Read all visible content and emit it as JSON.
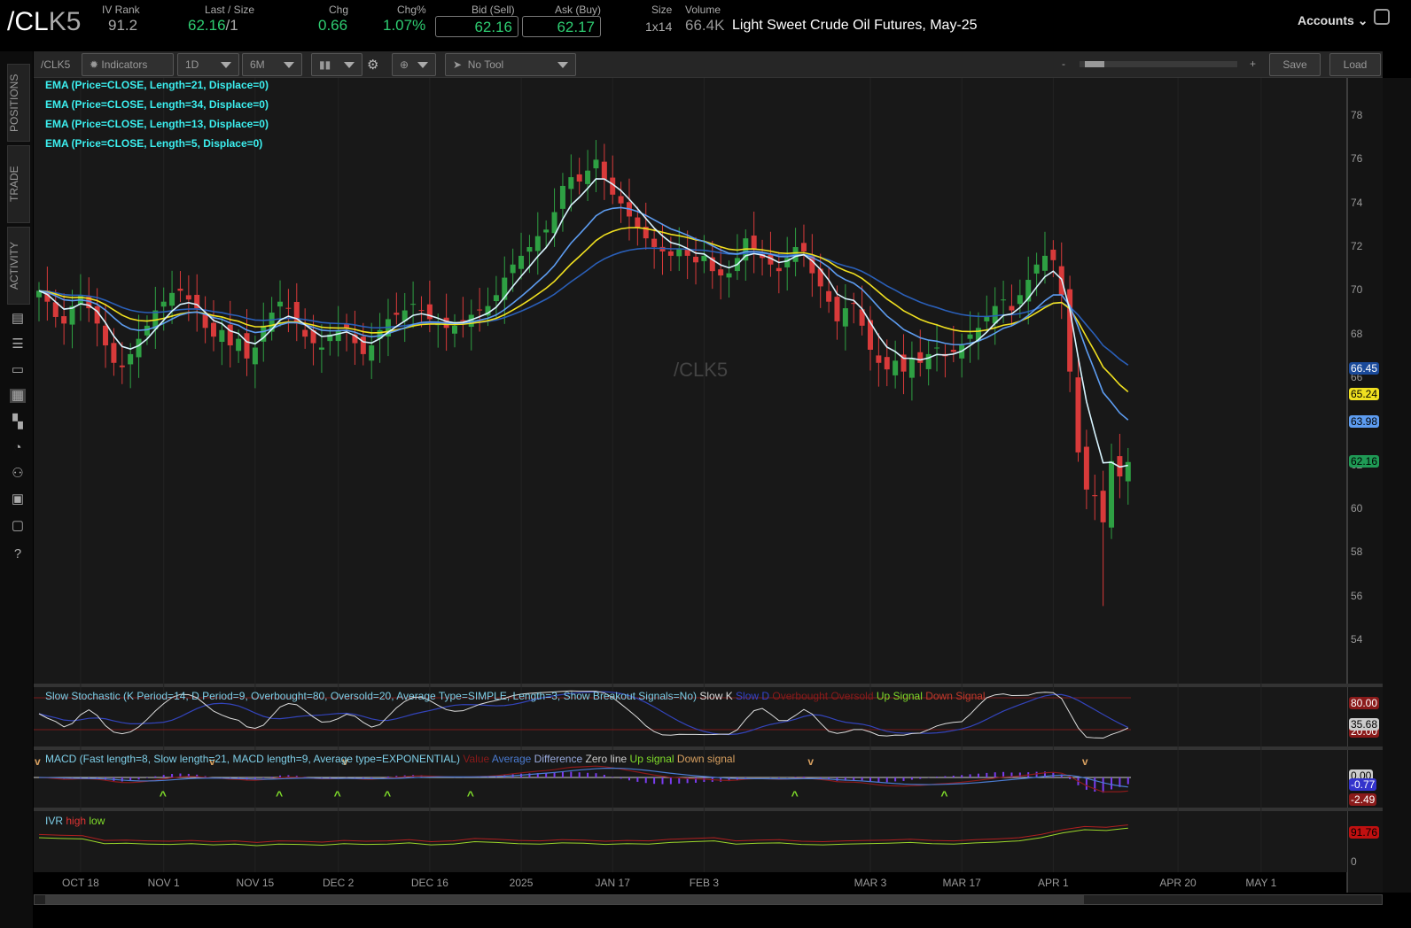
{
  "header": {
    "symbol_a": "/CL",
    "symbol_b": "K5",
    "iv_rank_label": "IV Rank",
    "iv_rank": "91.2",
    "last_label": "Last / Size",
    "last": "62.16",
    "size": "/1",
    "chg_label": "Chg",
    "chg": "0.66",
    "chgp_label": "Chg%",
    "chgp": "1.07%",
    "bid_label": "Bid (Sell)",
    "bid": "62.16",
    "ask_label": "Ask (Buy)",
    "ask": "62.17",
    "size_label": "Size",
    "size_val": "1x14",
    "volume_label": "Volume",
    "volume": "66.4K",
    "description": "Light Sweet Crude Oil Futures, May-25",
    "accounts": "Accounts"
  },
  "toolbar": {
    "symbol": "/CLK5",
    "indicators": "Indicators",
    "interval": "1D",
    "range": "6M",
    "tool": "No Tool",
    "zoom_minus": "-",
    "zoom_plus": "+",
    "save": "Save",
    "load": "Load"
  },
  "sidebar": {
    "tabs": [
      "POSITIONS",
      "TRADE",
      "ACTIVITY"
    ]
  },
  "studies": [
    "EMA (Price=CLOSE, Length=21, Displace=0)",
    "EMA (Price=CLOSE, Length=34, Displace=0)",
    "EMA (Price=CLOSE, Length=13, Displace=0)",
    "EMA (Price=CLOSE, Length=5, Displace=0)"
  ],
  "watermark": "/CLK5",
  "stoch": {
    "title": "Slow Stochastic (K Period=14, D Period=9, Overbought=80, Oversold=20, Average Type=SIMPLE, Length=3, Show Breakout Signals=No)",
    "legend": [
      "Slow K",
      "Slow D",
      "Overbought",
      "Oversold",
      "Up Signal",
      "Down Signal"
    ],
    "tags": [
      "80.00",
      "35.68",
      "20.00"
    ]
  },
  "macd": {
    "title": "MACD (Fast length=8, Slow length=21, MACD length=9, Average type=EXPONENTIAL)",
    "legend": [
      "Value",
      "Average",
      "Difference",
      "Zero line",
      "Up signal",
      "Down signal"
    ],
    "tags": [
      "0.00",
      "-0.77",
      "-2.49"
    ]
  },
  "ivr": {
    "title": "IVR",
    "legend": [
      "high",
      "low"
    ],
    "tags": [
      "91.76",
      "0"
    ],
    "series": [
      60,
      58,
      57,
      45,
      46,
      44,
      43,
      45,
      42,
      44,
      40,
      44,
      43,
      41,
      45,
      43,
      44,
      47,
      42,
      44,
      50,
      48,
      45,
      44,
      47,
      46,
      43,
      45,
      44,
      48,
      50,
      52,
      44,
      46,
      47,
      43,
      42,
      44,
      45,
      46,
      48,
      45,
      44,
      47,
      49,
      52,
      60,
      72,
      80,
      78,
      84
    ]
  },
  "price_tags": {
    "ema34": "66.45",
    "ema21": "65.24",
    "ema13": "63.98",
    "last": "62.16"
  },
  "colors": {
    "up": "#2ea043",
    "down": "#d83a3a",
    "ema21": "#f0e020",
    "ema34": "#2a5fb8",
    "ema13": "#5d9cf0",
    "ema5": "#d8f4ff"
  },
  "chart_data": {
    "type": "candlestick",
    "ylim": [
      53,
      79
    ],
    "yticks": [
      78,
      76,
      74,
      72,
      70,
      68,
      66,
      64,
      62,
      60,
      58,
      56,
      54
    ],
    "xlabels": [
      "OCT 18",
      "NOV 1",
      "NOV 15",
      "DEC 2",
      "DEC 16",
      "2025",
      "JAN 17",
      "FEB 3",
      "MAR 3",
      "MAR 17",
      "APR 1",
      "APR 20",
      "MAY 1"
    ],
    "xlabel_bar_index": [
      5,
      15,
      26,
      36,
      47,
      58,
      69,
      80,
      100,
      111,
      122,
      137,
      147
    ],
    "closes": [
      70,
      69.5,
      68.8,
      68.5,
      69.3,
      69.8,
      69.2,
      68.5,
      67.5,
      66.7,
      66.5,
      67.1,
      67.8,
      68.4,
      69.1,
      69.5,
      69.9,
      70,
      69.6,
      69.2,
      68.3,
      67.9,
      68.2,
      67.5,
      67.8,
      66.9,
      67.4,
      68.4,
      69,
      69.5,
      69.2,
      68.5,
      67.9,
      67.6,
      67.4,
      68,
      68.2,
      68.3,
      67.6,
      67.1,
      67.5,
      68.2,
      68.7,
      68.9,
      69.1,
      69.4,
      69.1,
      68.7,
      68.5,
      68.3,
      68.4,
      68.6,
      68.9,
      69.1,
      69.3,
      69.8,
      70.6,
      71.2,
      71.6,
      72,
      72.5,
      72.8,
      73.6,
      74.8,
      75.2,
      75,
      75.5,
      76,
      75.1,
      74.4,
      74,
      73.4,
      72.9,
      72.4,
      72,
      71.8,
      71.6,
      71.9,
      71.6,
      71.3,
      71.6,
      70.9,
      70.7,
      70.8,
      71.5,
      72.4,
      71.9,
      71.5,
      71.2,
      70.9,
      71.5,
      72,
      71.8,
      70.8,
      70.2,
      69.5,
      68.6,
      69.2,
      69.4,
      68.4,
      67.3,
      66.7,
      66.4,
      66.8,
      66.3,
      66.9,
      66.7,
      67.1,
      67.4,
      67,
      67.2,
      67.5,
      68,
      68.3,
      68.8,
      69.3,
      69.6,
      69.1,
      69.8,
      70.5,
      71.2,
      71.6,
      71.4,
      69.8,
      66.3,
      62.6,
      60.9,
      60.6,
      59.4,
      62.2,
      61.5,
      62.16
    ]
  }
}
